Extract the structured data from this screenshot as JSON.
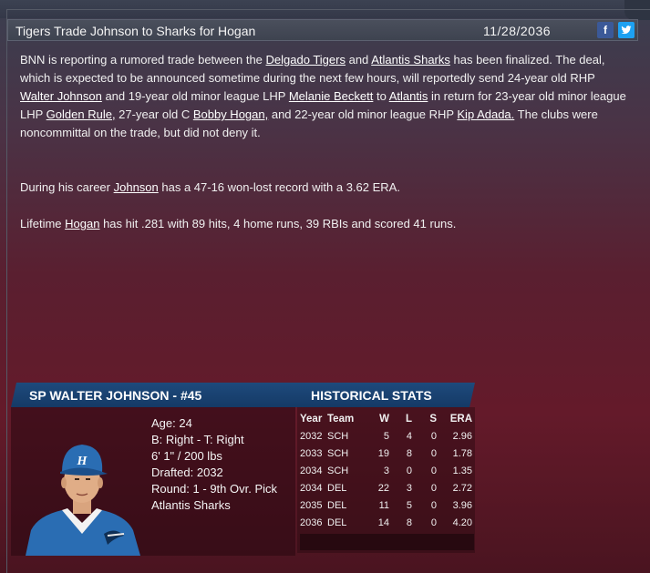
{
  "headline": {
    "title": "Tigers Trade Johnson to Sharks for Hogan",
    "date": "11/28/2036",
    "facebook_icon": "f",
    "twitter_icon": "t"
  },
  "article": {
    "p1": [
      {
        "t": "BNN is reporting a rumored trade between the "
      },
      {
        "t": "Delgado Tigers",
        "link": true
      },
      {
        "t": " and "
      },
      {
        "t": "Atlantis Sharks",
        "link": true
      },
      {
        "t": " has been finalized. The deal, which is expected to be announced sometime during the next few hours, will reportedly send 24-year old RHP "
      },
      {
        "t": "Walter Johnson",
        "link": true
      },
      {
        "t": " and 19-year old minor league LHP "
      },
      {
        "t": "Melanie Beckett",
        "link": true
      },
      {
        "t": " to "
      },
      {
        "t": "Atlantis",
        "link": true
      },
      {
        "t": " in return for 23-year old minor league LHP "
      },
      {
        "t": "Golden Rule,",
        "link": true
      },
      {
        "t": " 27-year old C "
      },
      {
        "t": "Bobby Hogan,",
        "link": true
      },
      {
        "t": " and 22-year old minor league RHP "
      },
      {
        "t": "Kip Adada.",
        "link": true
      },
      {
        "t": " The clubs were noncommittal on the trade, but did not deny it."
      }
    ],
    "p2": [
      {
        "t": "During his career "
      },
      {
        "t": "Johnson",
        "link": true
      },
      {
        "t": " has a 47-16 won-lost record with a 3.62 ERA."
      }
    ],
    "p3": [
      {
        "t": "Lifetime "
      },
      {
        "t": "Hogan",
        "link": true
      },
      {
        "t": " has hit .281 with 89 hits, 4 home runs, 39 RBIs and scored 41 runs."
      }
    ]
  },
  "player_card": {
    "name": "SP WALTER JOHNSON - #45",
    "historical_title": "HISTORICAL STATS",
    "portrait_icon": "player-portrait",
    "age": "Age: 24",
    "bats_throws": "B: Right - T: Right",
    "height_weight": "6' 1\" / 200 lbs",
    "drafted": "Drafted: 2032",
    "round": "Round: 1 - 9th Ovr. Pick",
    "team": "Atlantis Sharks",
    "stats_headers": [
      "Year",
      "Team",
      "W",
      "L",
      "S",
      "ERA"
    ],
    "stats_rows": [
      [
        "2032",
        "SCH",
        "5",
        "4",
        "0",
        "2.96"
      ],
      [
        "2033",
        "SCH",
        "19",
        "8",
        "0",
        "1.78"
      ],
      [
        "2034",
        "SCH",
        "3",
        "0",
        "0",
        "1.35"
      ],
      [
        "2034",
        "DEL",
        "22",
        "3",
        "0",
        "2.72"
      ],
      [
        "2035",
        "DEL",
        "11",
        "5",
        "0",
        "3.96"
      ],
      [
        "2036",
        "DEL",
        "14",
        "8",
        "0",
        "4.20"
      ]
    ]
  },
  "colors": {
    "header_blue": "#1e4a7c",
    "facebook": "#3b5998",
    "twitter": "#1da1f2",
    "jersey": "#2a6db3"
  }
}
